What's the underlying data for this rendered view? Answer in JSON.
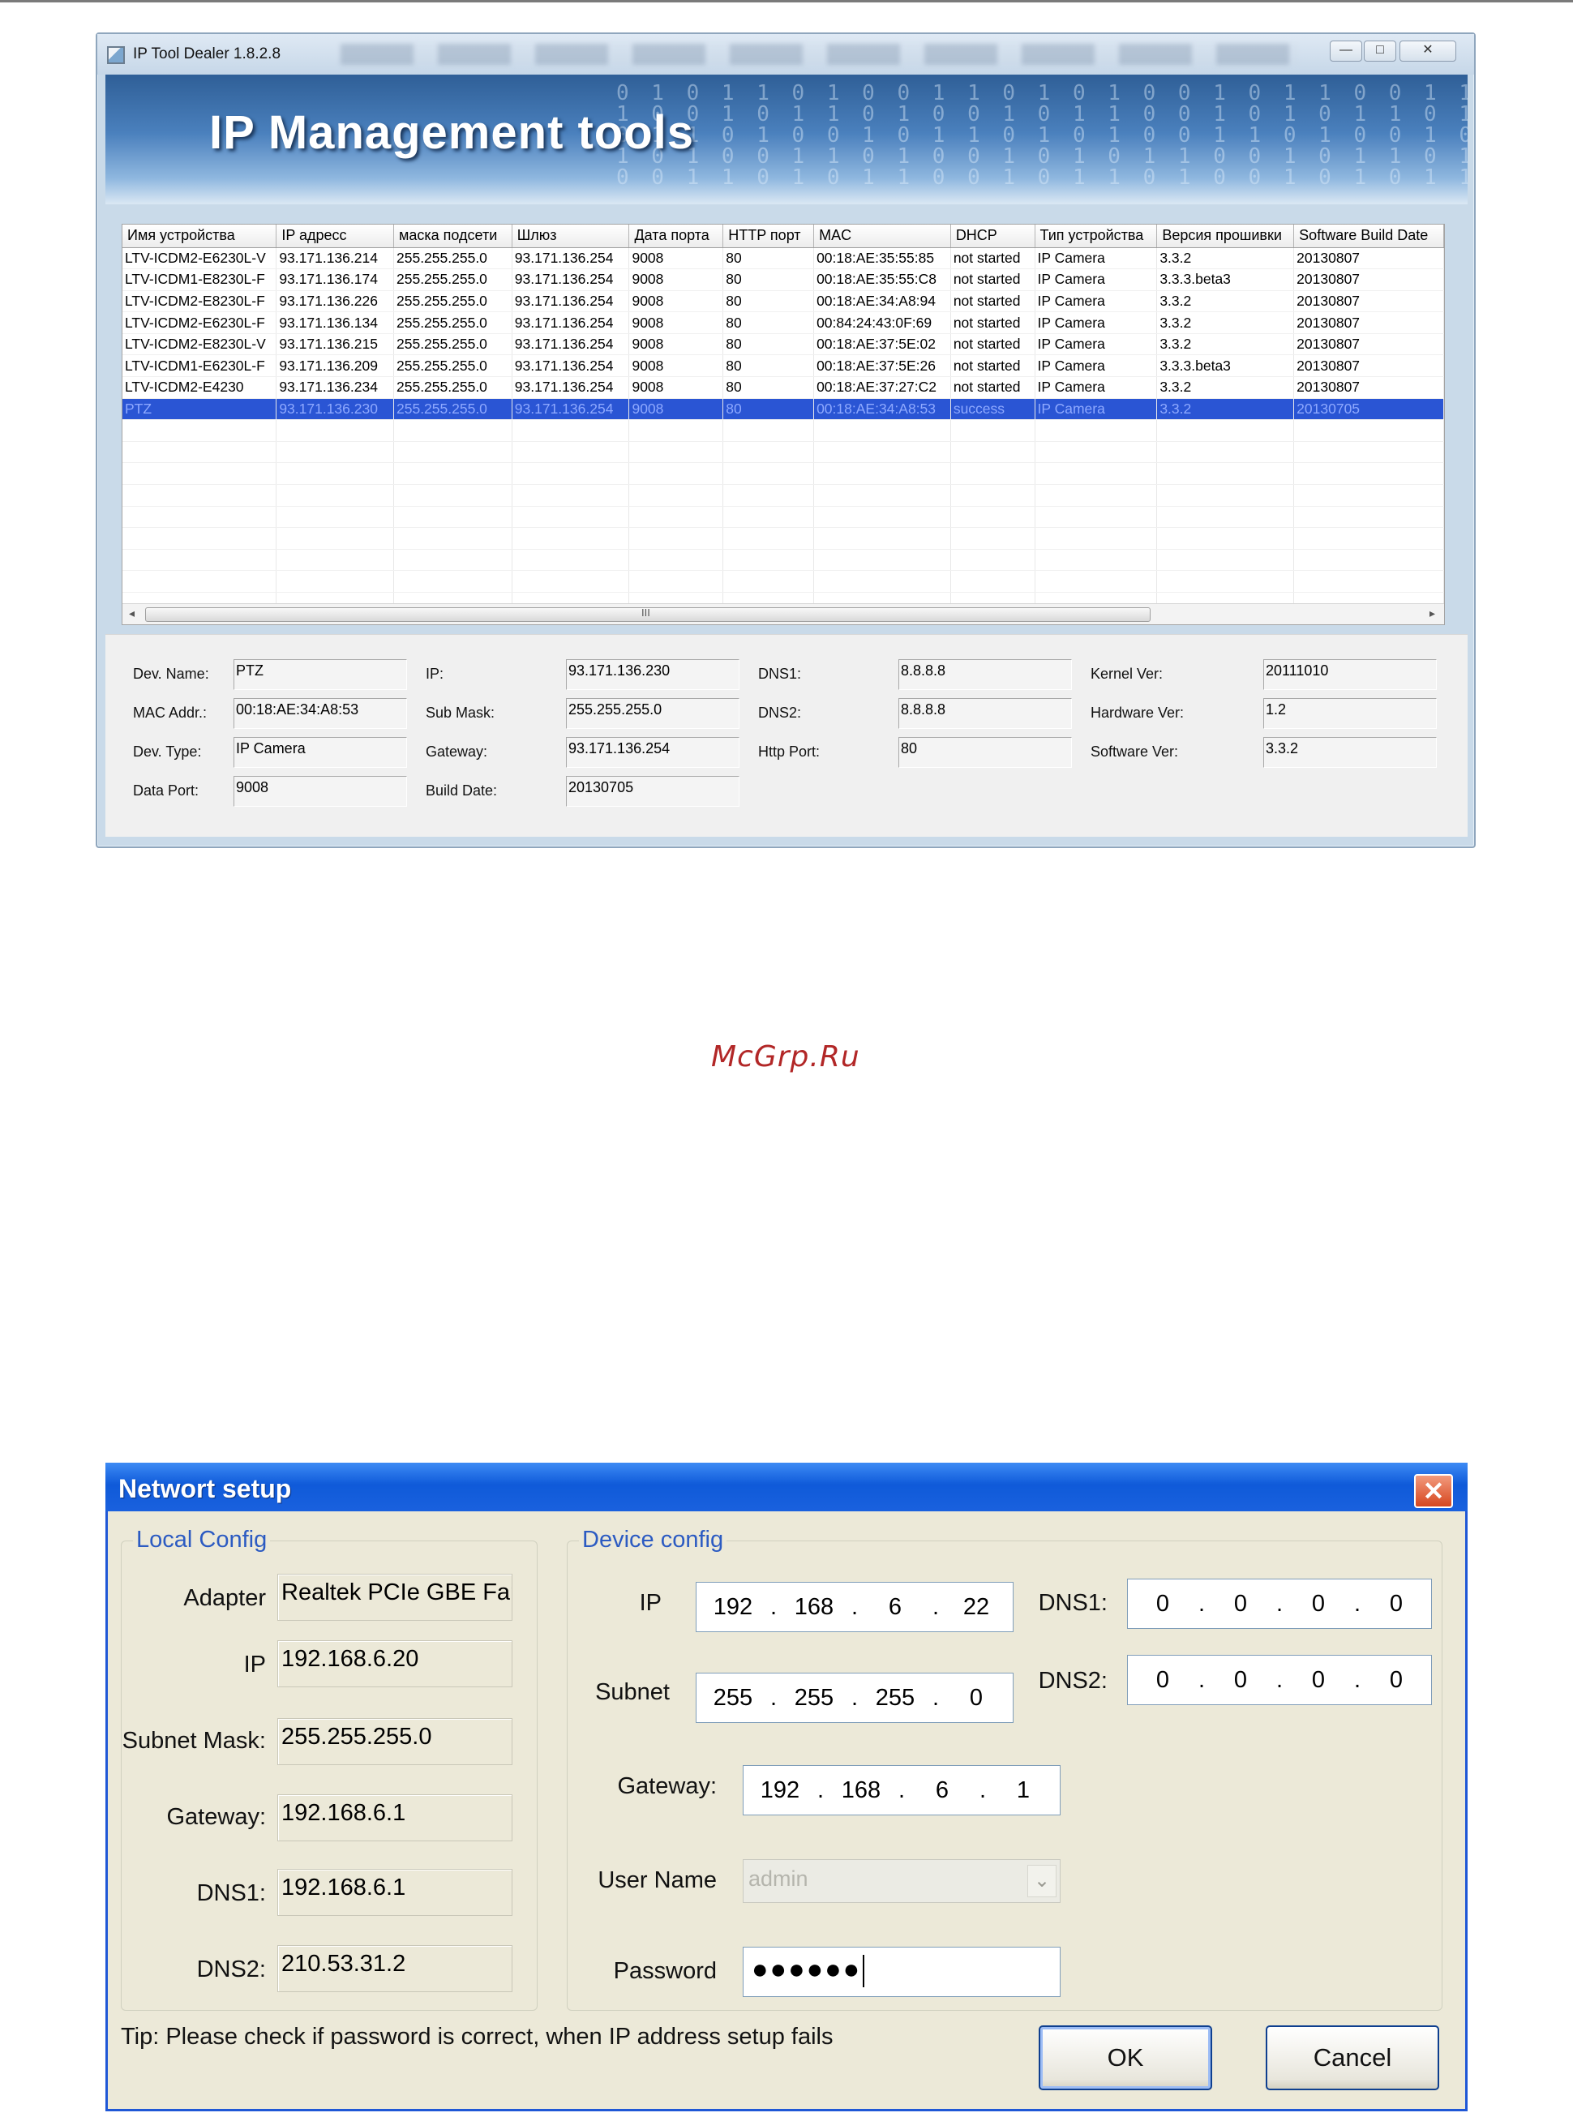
{
  "window1": {
    "title": "IP Tool Dealer 1.8.2.8",
    "window_buttons": {
      "minimize": "—",
      "maximize": "□",
      "close": "✕"
    },
    "banner_title": "IP Management tools",
    "table": {
      "columns": [
        "Имя устройства",
        "IP адресс",
        "маска подсети",
        "Шлюз",
        "Дата порта",
        "HTTP порт",
        "MAC",
        "DHCP",
        "Тип устройства",
        "Версия прошивки",
        "Software Build Date"
      ],
      "rows": [
        [
          "LTV-ICDM2-E6230L-V",
          "93.171.136.214",
          "255.255.255.0",
          "93.171.136.254",
          "9008",
          "80",
          "00:18:AE:35:55:85",
          "not started",
          "IP Camera",
          "3.3.2",
          "20130807"
        ],
        [
          "LTV-ICDM1-E8230L-F",
          "93.171.136.174",
          "255.255.255.0",
          "93.171.136.254",
          "9008",
          "80",
          "00:18:AE:35:55:C8",
          "not started",
          "IP Camera",
          "3.3.3.beta3",
          "20130807"
        ],
        [
          "LTV-ICDM2-E8230L-F",
          "93.171.136.226",
          "255.255.255.0",
          "93.171.136.254",
          "9008",
          "80",
          "00:18:AE:34:A8:94",
          "not started",
          "IP Camera",
          "3.3.2",
          "20130807"
        ],
        [
          "LTV-ICDM2-E6230L-F",
          "93.171.136.134",
          "255.255.255.0",
          "93.171.136.254",
          "9008",
          "80",
          "00:84:24:43:0F:69",
          "not started",
          "IP Camera",
          "3.3.2",
          "20130807"
        ],
        [
          "LTV-ICDM2-E8230L-V",
          "93.171.136.215",
          "255.255.255.0",
          "93.171.136.254",
          "9008",
          "80",
          "00:18:AE:37:5E:02",
          "not started",
          "IP Camera",
          "3.3.2",
          "20130807"
        ],
        [
          "LTV-ICDM1-E6230L-F",
          "93.171.136.209",
          "255.255.255.0",
          "93.171.136.254",
          "9008",
          "80",
          "00:18:AE:37:5E:26",
          "not started",
          "IP Camera",
          "3.3.3.beta3",
          "20130807"
        ],
        [
          "LTV-ICDM2-E4230",
          "93.171.136.234",
          "255.255.255.0",
          "93.171.136.254",
          "9008",
          "80",
          "00:18:AE:37:27:C2",
          "not started",
          "IP Camera",
          "3.3.2",
          "20130807"
        ],
        [
          "PTZ",
          "93.171.136.230",
          "255.255.255.0",
          "93.171.136.254",
          "9008",
          "80",
          "00:18:AE:34:A8:53",
          "success",
          "IP Camera",
          "3.3.2",
          "20130705"
        ]
      ],
      "selected_row": 7,
      "scroll_grip": "III",
      "scroll_left": "◂",
      "scroll_right": "▸"
    },
    "details": {
      "dev_name_label": "Dev. Name:",
      "dev_name": "PTZ",
      "mac_label": "MAC Addr.:",
      "mac": "00:18:AE:34:A8:53",
      "dev_type_label": "Dev. Type:",
      "dev_type": "IP Camera",
      "data_port_label": "Data Port:",
      "data_port": "9008",
      "ip_label": "IP:",
      "ip": "93.171.136.230",
      "sub_mask_label": "Sub Mask:",
      "sub_mask": "255.255.255.0",
      "gateway_label": "Gateway:",
      "gateway": "93.171.136.254",
      "build_date_label": "Build Date:",
      "build_date": "20130705",
      "dns1_label": "DNS1:",
      "dns1": "8.8.8.8",
      "dns2_label": "DNS2:",
      "dns2": "8.8.8.8",
      "http_port_label": "Http Port:",
      "http_port": "80",
      "kernel_label": "Kernel Ver:",
      "kernel": "20111010",
      "hardware_label": "Hardware Ver:",
      "hardware": "1.2",
      "software_label": "Software Ver:",
      "software": "3.3.2"
    }
  },
  "watermark": "McGrp.Ru",
  "window2": {
    "title": "Networt setup",
    "close_glyph": "✕",
    "local": {
      "group_title": "Local Config",
      "adapter_label": "Adapter",
      "adapter": "Realtek PCIe GBE Fan",
      "ip_label": "IP",
      "ip": "192.168.6.20",
      "subnet_label": "Subnet Mask:",
      "subnet": "255.255.255.0",
      "gateway_label": "Gateway:",
      "gateway": "192.168.6.1",
      "dns1_label": "DNS1:",
      "dns1": "192.168.6.1",
      "dns2_label": "DNS2:",
      "dns2": "210.53.31.2"
    },
    "device": {
      "group_title": "Device config",
      "ip_label": "IP",
      "ip": [
        "192",
        "168",
        "6",
        "22"
      ],
      "subnet_label": "Subnet",
      "subnet": [
        "255",
        "255",
        "255",
        "0"
      ],
      "gateway_label": "Gateway:",
      "gateway": [
        "192",
        "168",
        "6",
        "1"
      ],
      "dns1_label": "DNS1:",
      "dns1": [
        "0",
        "0",
        "0",
        "0"
      ],
      "dns2_label": "DNS2:",
      "dns2": [
        "0",
        "0",
        "0",
        "0"
      ],
      "username_label": "User Name",
      "username": "admin",
      "password_label": "Password",
      "password_mask": "●●●●●●"
    },
    "tip": "Tip:  Please check if password is correct, when IP address setup fails",
    "ok_label": "OK",
    "cancel_label": "Cancel"
  }
}
